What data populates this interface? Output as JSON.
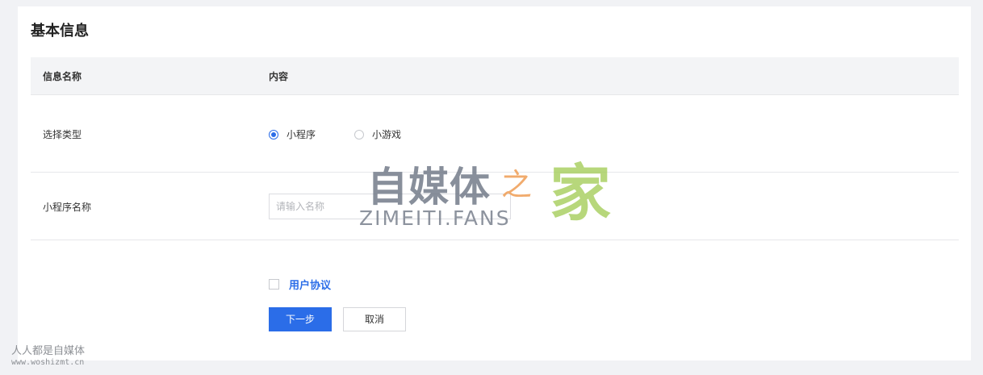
{
  "section": {
    "title": "基本信息"
  },
  "table": {
    "headers": [
      "信息名称",
      "内容"
    ],
    "rows": {
      "type": {
        "label": "选择类型",
        "options": [
          {
            "label": "小程序",
            "selected": true
          },
          {
            "label": "小游戏",
            "selected": false
          }
        ]
      },
      "name": {
        "label": "小程序名称",
        "placeholder": "请输入名称",
        "value": ""
      }
    }
  },
  "agreement": {
    "label": "用户协议",
    "checked": false
  },
  "buttons": {
    "next": "下一步",
    "cancel": "取消"
  },
  "watermark": {
    "main": "自媒体",
    "zhi": "之",
    "jia": "家",
    "en": "ZIMEITI.FANS"
  },
  "corner": {
    "text": "人人都是自媒体",
    "url": "www.woshizmt.cn"
  },
  "colors": {
    "primary": "#2b6de8",
    "page_bg": "#f1f2f5",
    "header_bg": "#f3f4f6"
  }
}
